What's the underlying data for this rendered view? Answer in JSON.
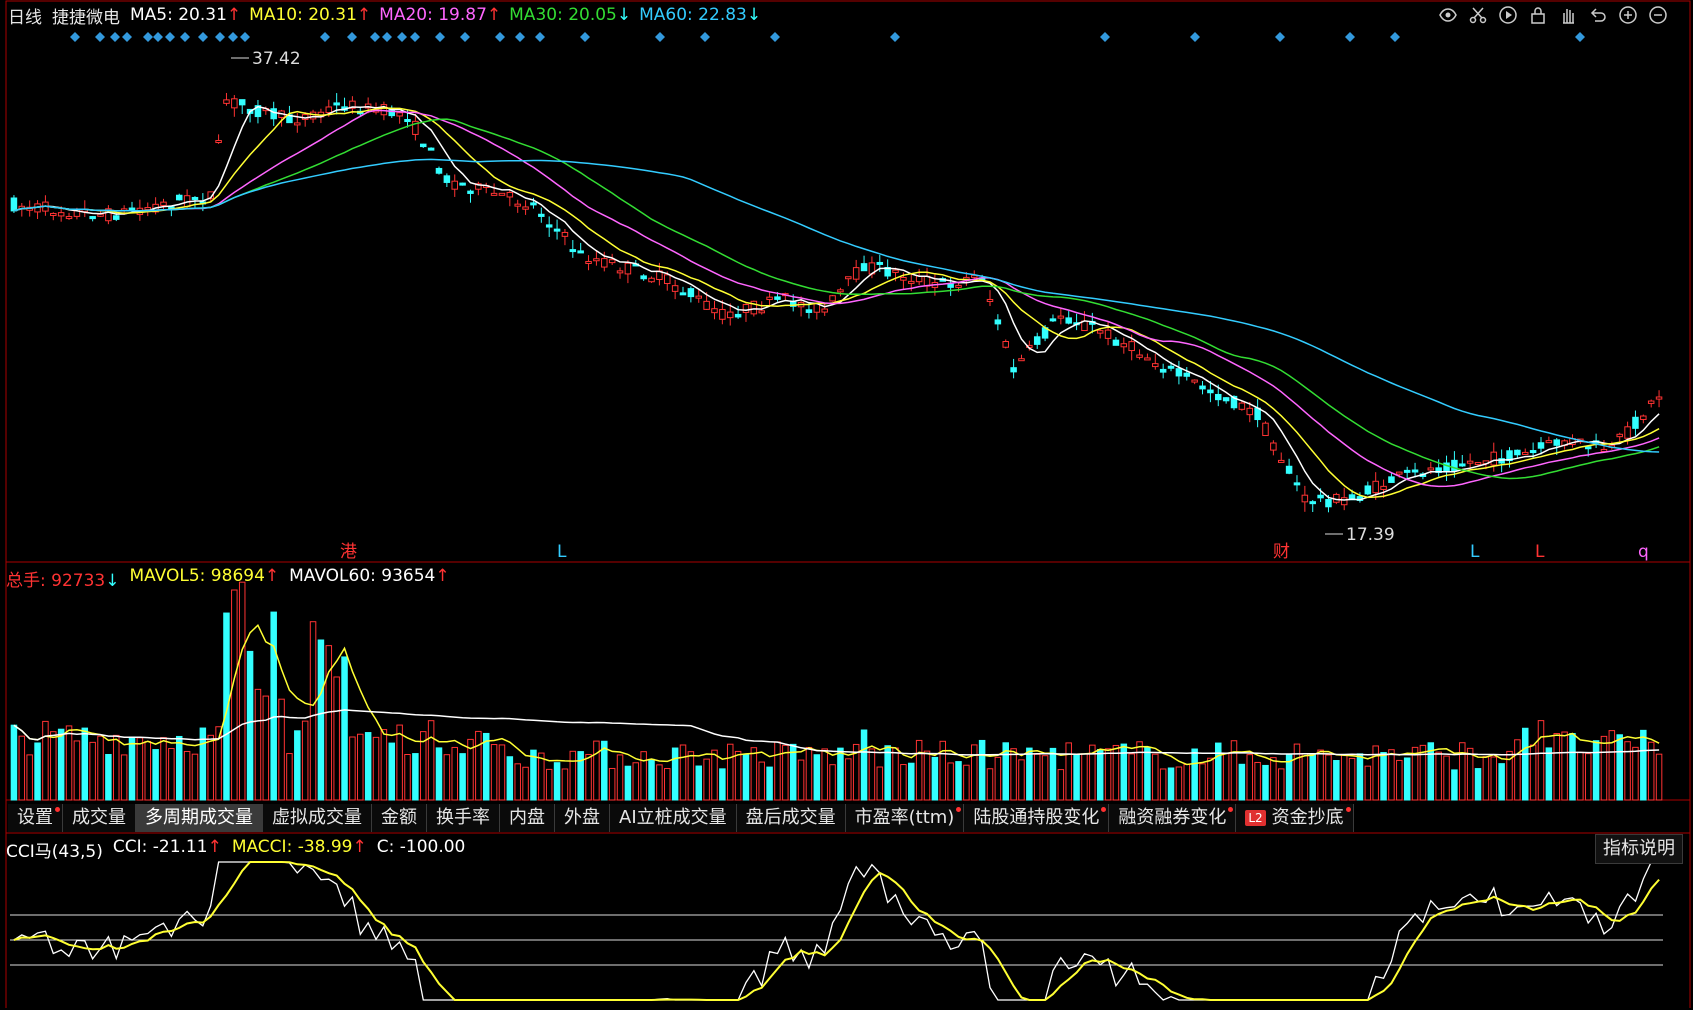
{
  "main": {
    "period": "日线",
    "stock_name": "捷捷微电",
    "ma": [
      {
        "label": "MA5: 20.31",
        "arrow": "↑",
        "color": "#ffffff"
      },
      {
        "label": "MA10: 20.31",
        "arrow": "↑",
        "color": "#ffff33"
      },
      {
        "label": "MA20: 19.87",
        "arrow": "↑",
        "color": "#ff66ff"
      },
      {
        "label": "MA30: 20.05",
        "arrow": "↓",
        "color": "#33dd33"
      },
      {
        "label": "MA60: 22.83",
        "arrow": "↓",
        "color": "#33ccff"
      }
    ],
    "high_label": "37.42",
    "low_label": "17.39",
    "markers": [
      "港",
      "L",
      "财",
      "L",
      "L",
      "q"
    ]
  },
  "toolbar": {
    "icons": [
      "eye-icon",
      "scissors-icon",
      "play-icon",
      "lock-icon",
      "hand-icon",
      "undo-icon",
      "zoom-in-icon",
      "zoom-out-icon"
    ]
  },
  "volume": {
    "total": "总手: 92733",
    "total_arrow": "↓",
    "mavol5": "MAVOL5: 98694",
    "mavol5_arrow": "↑",
    "mavol60": "MAVOL60: 93654",
    "mavol60_arrow": "↑"
  },
  "tabs": [
    {
      "label": "设置",
      "dot": true,
      "active": false
    },
    {
      "label": "成交量",
      "dot": false,
      "active": false
    },
    {
      "label": "多周期成交量",
      "dot": false,
      "active": true
    },
    {
      "label": "虚拟成交量",
      "dot": false,
      "active": false
    },
    {
      "label": "金额",
      "dot": false,
      "active": false
    },
    {
      "label": "换手率",
      "dot": false,
      "active": false
    },
    {
      "label": "内盘",
      "dot": false,
      "active": false
    },
    {
      "label": "外盘",
      "dot": false,
      "active": false
    },
    {
      "label": "AI立桩成交量",
      "dot": false,
      "active": false
    },
    {
      "label": "盘后成交量",
      "dot": false,
      "active": false
    },
    {
      "label": "市盈率(ttm)",
      "dot": true,
      "active": false
    },
    {
      "label": "陆股通持股变化",
      "dot": true,
      "active": false
    },
    {
      "label": "融资融券变化",
      "dot": true,
      "active": false
    },
    {
      "label": "资金抄底",
      "dot": true,
      "active": false,
      "badge": "L2"
    }
  ],
  "cci": {
    "name": "CCI马(43,5)",
    "cci": "CCI: -21.11",
    "cci_arrow": "↑",
    "macci": "MACCI: -38.99",
    "macci_arrow": "↑",
    "c": "C: -100.00"
  },
  "explain_label": "指标说明",
  "colors": {
    "up": "#ff3333",
    "down": "#33ffff",
    "frame": "#aa0000",
    "grid": "#2a2a2a"
  }
}
